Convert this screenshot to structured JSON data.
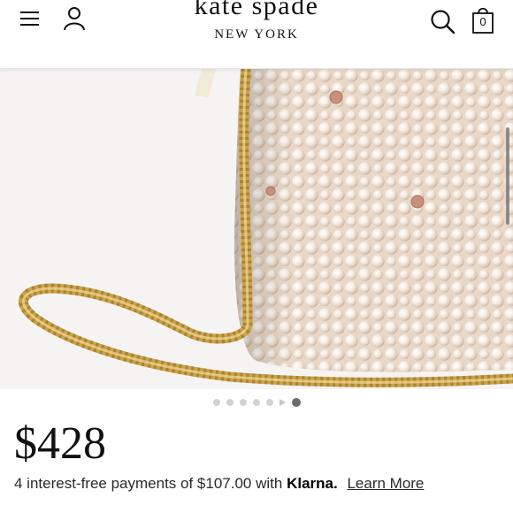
{
  "header": {
    "brand_name": "kate spade",
    "brand_sub": "NEW YORK",
    "bag_count": "0",
    "icons": [
      "menu-icon",
      "account-icon",
      "search-icon",
      "shopping-bag-icon"
    ]
  },
  "carousel": {
    "dot_count": 6,
    "active_index": 6,
    "has_video_indicator": true
  },
  "product": {
    "price": "$428",
    "klarna_prefix": "4 interest-free payments of $107.00 with",
    "klarna_brand": "Klarna.",
    "learn_more": "Learn More"
  },
  "colors": {
    "pearl": "#f1e6dc",
    "gold_chain": "#caa24a",
    "active_dot": "#6b6b6b",
    "inactive_dot": "#d2d2d2"
  }
}
